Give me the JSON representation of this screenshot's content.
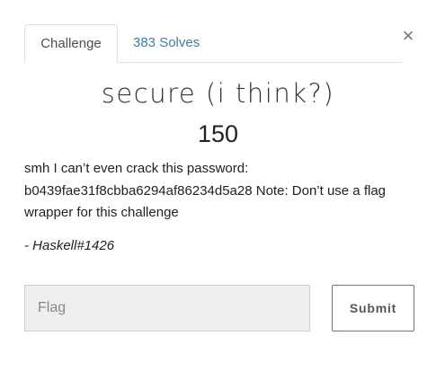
{
  "tabs": {
    "challenge_label": "Challenge",
    "solves_label": "383 Solves"
  },
  "close_glyph": "×",
  "challenge": {
    "name": "secure (i think?)",
    "value": "150",
    "description": "smh I can’t even crack this password: b0439fae31f8cbba6294af86234d5a28 Note: Don’t use a flag wrapper for this challenge",
    "author": "- Haskell#1426"
  },
  "flag_form": {
    "placeholder": "Flag",
    "submit_label": "Submit"
  },
  "colors": {
    "link": "#3d7ea6",
    "input_bg": "#eeeeee",
    "border": "#dee2e6"
  },
  "icons": {
    "close": "close-icon"
  }
}
